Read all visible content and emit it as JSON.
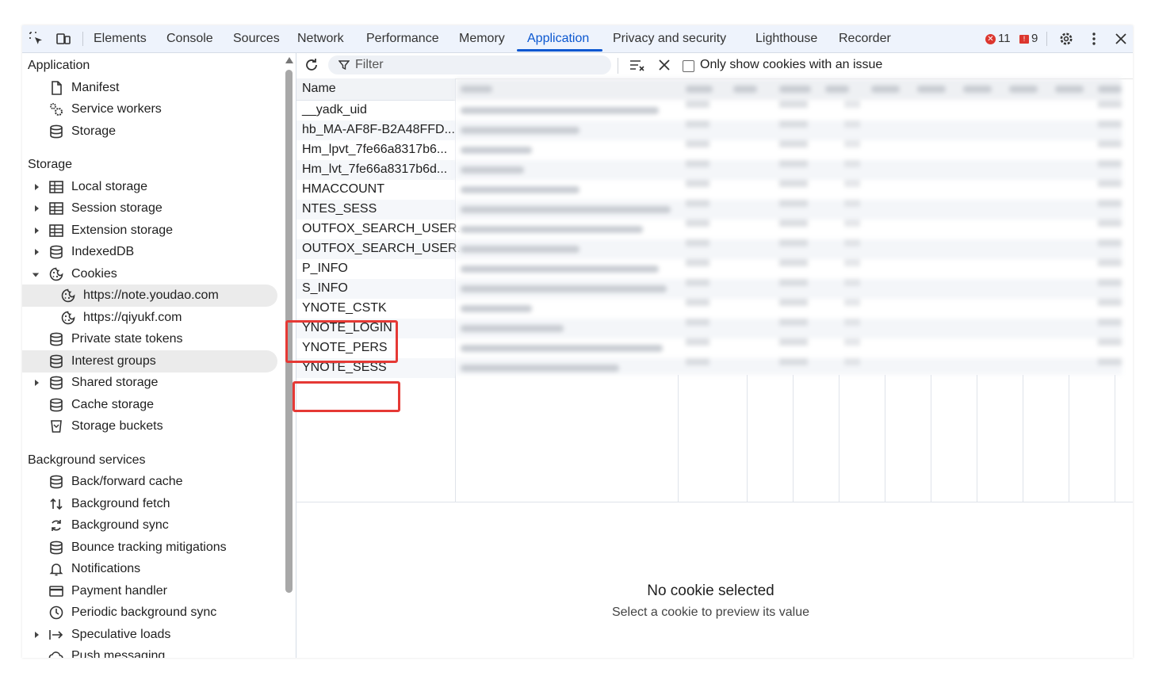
{
  "toolbar": {
    "tabs": [
      "Elements",
      "Console",
      "Sources",
      "Network",
      "Performance",
      "Memory",
      "Application",
      "Privacy and security",
      "Lighthouse",
      "Recorder"
    ],
    "active_tab": "Application",
    "errors_count": "11",
    "issues_count": "9",
    "accent_color": "#0b57d0"
  },
  "sidebar": {
    "application_header": "Application",
    "application_items": [
      "Manifest",
      "Service workers",
      "Storage"
    ],
    "storage_header": "Storage",
    "storage_items": [
      "Local storage",
      "Session storage",
      "Extension storage",
      "IndexedDB",
      "Cookies",
      "https://note.youdao.com",
      "https://qiyukf.com",
      "Private state tokens",
      "Interest groups",
      "Shared storage",
      "Cache storage",
      "Storage buckets"
    ],
    "background_header": "Background services",
    "background_items": [
      "Back/forward cache",
      "Background fetch",
      "Background sync",
      "Bounce tracking mitigations",
      "Notifications",
      "Payment handler",
      "Periodic background sync",
      "Speculative loads",
      "Push messaging"
    ],
    "selected_item": "https://note.youdao.com"
  },
  "filterbar": {
    "filter_placeholder": "Filter",
    "only_issues_label": "Only show cookies with an issue",
    "only_issues_checked": false
  },
  "cookies_table": {
    "name_header": "Name",
    "names": [
      "__yadk_uid",
      "hb_MA-AF8F-B2A48FFD...",
      "Hm_lpvt_7fe66a8317b6...",
      "Hm_lvt_7fe66a8317b6d...",
      "HMACCOUNT",
      "NTES_SESS",
      "OUTFOX_SEARCH_USER...",
      "OUTFOX_SEARCH_USER...",
      "P_INFO",
      "S_INFO",
      "YNOTE_CSTK",
      "YNOTE_LOGIN",
      "YNOTE_PERS",
      "YNOTE_SESS"
    ],
    "highlighted": [
      "YNOTE_CSTK",
      "YNOTE_LOGIN",
      "YNOTE_SESS"
    ],
    "highlight_color": "#e53935"
  },
  "preview": {
    "title": "No cookie selected",
    "subtitle": "Select a cookie to preview its value"
  }
}
